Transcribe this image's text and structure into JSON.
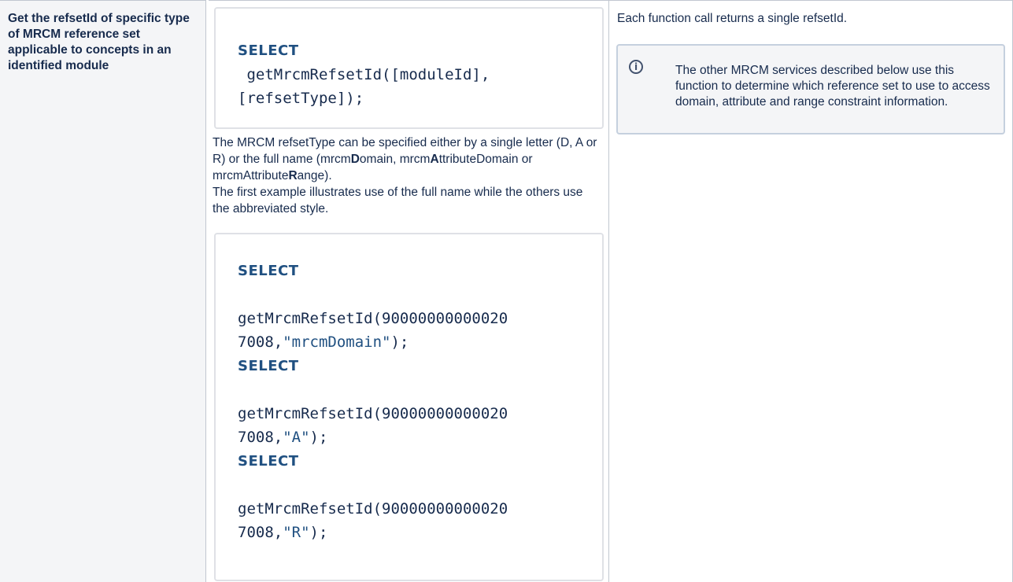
{
  "row_header": "Get the refsetId of specific type of MRCM reference set applicable to concepts in an identified module",
  "code1": {
    "keyword": "SELECT",
    "line1": " getMrcmRefsetId([moduleId],",
    "line2": "[refsetType]);"
  },
  "description": {
    "part1": "The MRCM refsetType can be specified either by a single letter (D, A or R) or the full name (mrcm",
    "bold1": "D",
    "part2": "omain, mrcm",
    "bold2": "A",
    "part3": "ttributeDomain or mrcmAttribute",
    "bold3": "R",
    "part4": "ange).",
    "line2": "The first example illustrates use of the full name while the others use the abbreviated style."
  },
  "examples": [
    {
      "keyword": "SELECT",
      "call_line1": "getMrcmRefsetId(90000000000020",
      "call_line2_prefix": "7008,",
      "arg": "\"mrcmDomain\"",
      "suffix": ");"
    },
    {
      "keyword": "SELECT",
      "call_line1": "getMrcmRefsetId(90000000000020",
      "call_line2_prefix": "7008,",
      "arg": "\"A\"",
      "suffix": ");"
    },
    {
      "keyword": "SELECT",
      "call_line1": "getMrcmRefsetId(90000000000020",
      "call_line2_prefix": "7008,",
      "arg": "\"R\"",
      "suffix": ");"
    }
  ],
  "result_text": "Each function call returns a single refsetId.",
  "info_panel": {
    "icon": "info-icon",
    "text": "The other MRCM services described below use this function to determine which reference set to use to access domain, attribute and range constraint information."
  }
}
